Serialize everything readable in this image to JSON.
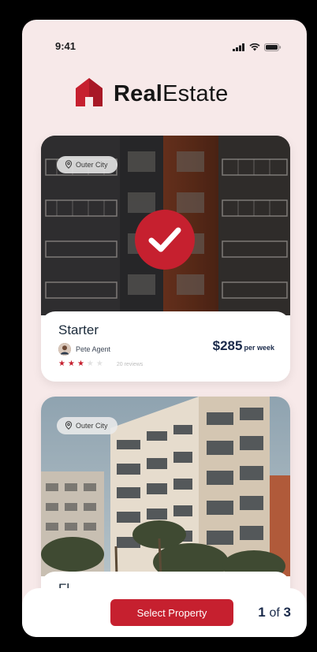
{
  "status": {
    "time": "9:41",
    "icons": [
      "signal-icon",
      "wifi-icon",
      "battery-icon"
    ]
  },
  "brand": {
    "name_bold": "Real",
    "name_rest": "Estate",
    "logo_icon": "house-icon",
    "accent": "#c6202f"
  },
  "properties": [
    {
      "location": "Outer City",
      "title": "Starter",
      "agent": "Pete Agent",
      "rating": 3,
      "max_rating": 5,
      "reviews": "20 reviews",
      "price": "$285",
      "price_unit": "per week",
      "selected": true
    },
    {
      "location": "Outer City",
      "title": "Fl"
    }
  ],
  "footer": {
    "button_label": "Select Property",
    "current": "1",
    "of": "of",
    "total": "3"
  }
}
